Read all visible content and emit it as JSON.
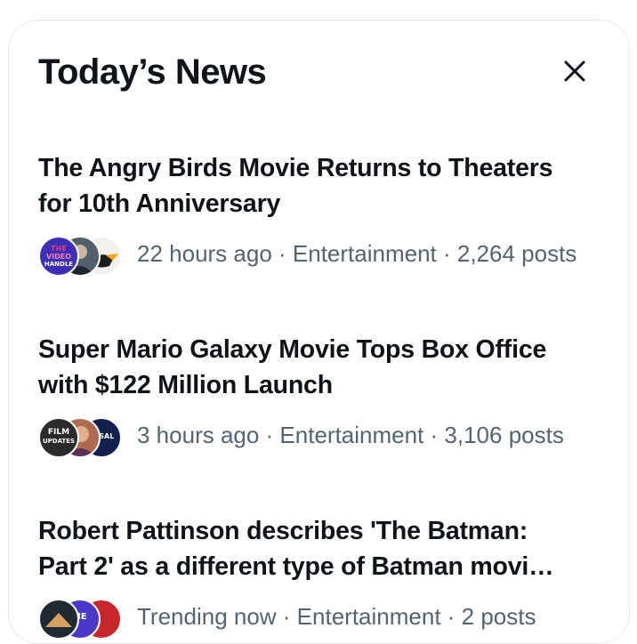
{
  "panel": {
    "title": "Today’s News"
  },
  "news": [
    {
      "headline_line1": "The Angry Birds Movie Returns to Theaters",
      "headline_line2": "for 10th Anniversary",
      "meta": "22 hours ago · Entertainment · 2,264 posts",
      "avatars": [
        {
          "name": "the-nerdy-video-handle-avatar",
          "text": "THE VIDEO HANDLE",
          "bg": "#3b2fb5",
          "fg": "#e83a7d"
        },
        {
          "name": "news-reporter-avatar",
          "bg": "#52606b"
        },
        {
          "name": "angry-bird-avatar",
          "bg": "#f3f1ee"
        }
      ]
    },
    {
      "headline_line1": "Super Mario Galaxy Movie Tops Box Office",
      "headline_line2": "with $122 Million Launch",
      "meta": "3 hours ago · Entertainment · 3,106 posts",
      "avatars": [
        {
          "name": "film-updates-avatar",
          "text": "FILM UPDATES",
          "bg": "#2b2b2b",
          "fg": "#ffffff"
        },
        {
          "name": "movie-fan-avatar",
          "bg": "#b06a4f"
        },
        {
          "name": "universal-avatar",
          "text": "ERSAL",
          "bg": "#12214d",
          "fg": "#ffffff"
        }
      ]
    },
    {
      "headline_line1": "Robert Pattinson describes 'The Batman:",
      "headline_line2": "Part 2' as a different type of Batman movi…",
      "meta": "Trending now · Entertainment · 2 posts",
      "avatars": [
        {
          "name": "batman-fan-avatar",
          "bg": "#1f2a33"
        },
        {
          "name": "the-hero-avatar",
          "text": "HE",
          "bg": "#4a39c9",
          "fg": "#ffffff"
        },
        {
          "name": "red-poster-avatar",
          "bg": "#c7262b"
        }
      ]
    }
  ],
  "colors": {
    "text_primary": "#0f1419",
    "text_secondary": "#536471",
    "border": "#e7e9ea"
  }
}
